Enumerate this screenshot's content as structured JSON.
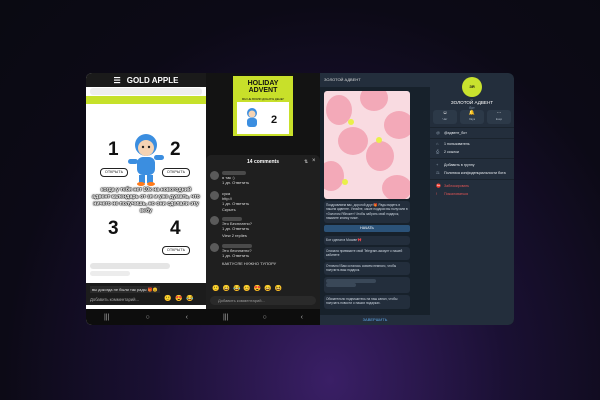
{
  "panel1": {
    "brand": "GOLD APPLE",
    "numbers": [
      "1",
      "2",
      "3",
      "4"
    ],
    "open_label": "ОТКРЫТЬ",
    "caption": "когда у тебя нет 10к на новогодний адвент календарь от зя и уже думать, что ничего не получишь, но они сделали эту вебу",
    "comment_chip": "вы докогда не были так рады 🎁😊",
    "comment_placeholder": "Добавить комментарий...",
    "emojis": [
      "🙂",
      "😍",
      "😂"
    ],
    "nav": [
      "|||",
      "○",
      "‹"
    ]
  },
  "panel2": {
    "card_title_1": "HOLIDAY",
    "card_title_2": "ADVENT",
    "card_sub": "МЫ НЕ ВЗЯЛИ ДОНАТЫ ДЕНЕГ",
    "card_num": "2",
    "comments_title": "14 comments",
    "comments": [
      {
        "text": "я так :)",
        "meta": "1 дн. Ответить"
      },
      {
        "text": "сука",
        "meta": ""
      },
      {
        "text": "http://",
        "meta": "1 дн. Ответить"
      },
      {
        "text": "Скрыть",
        "meta": ""
      },
      {
        "text": "Это Бесплатно?",
        "meta": "1 дн. Ответить"
      },
      {
        "text": "View 2 replies",
        "meta": ""
      },
      {
        "text": "Это бесплатно?",
        "meta": "1 дн. Ответить"
      },
      {
        "text": "КАКТУСЯЕ НУЖНО ТУПОРУ",
        "meta": ""
      }
    ],
    "emoji_row": "🙂😀😂😊😍😄😆",
    "comment_placeholder": "Добавить комментарий...",
    "nav": [
      "|||",
      "○",
      "‹"
    ]
  },
  "panel3": {
    "chat_title": "ЗОЛОТОЙ АДВЕНТ",
    "msg1": "Поздравляем вас, дорогой друг!🎁 Рады видеть в нашем адвенте. Узнайте, какие подарки вы получили в «Золотом Яблоке»! Чтобы забрать свой подарок, нажмите кнопку ниже.",
    "btn1": "НАЧАТЬ",
    "msg2": "Бот сделан в Москве 🎀",
    "msg3": "Сначала привяжите свой Telegram-аккаунт к нашей кабинете",
    "msg4": "Отлично! Вам осталось совсем немного, чтобы получить ваш подарок.",
    "msg5": "Обязательно подпишитесь на наш канал, чтобы получать новости о наших подарках.",
    "bottom": "ЗАВЕРШИТЬ"
  },
  "panel4": {
    "logo": "ЗЯ",
    "name": "ЗОЛОТОЙ АДВЕНТ",
    "sub": "бот",
    "actions": [
      {
        "icon": "☺",
        "label": "Чат"
      },
      {
        "icon": "🔔",
        "label": "Звук"
      },
      {
        "icon": "⋯",
        "label": "Ещё"
      }
    ],
    "rows": [
      {
        "icon": "@",
        "label": "@адвент_бот"
      },
      {
        "icon": "⌂",
        "label": "1 пользователь"
      },
      {
        "icon": "⎙",
        "label": "2 ссылки"
      },
      {
        "icon": "+",
        "label": "Добавить в группу"
      },
      {
        "icon": "⚖",
        "label": "Политика конфиденциальности бота"
      },
      {
        "icon": "⛔",
        "label": "Заблокировать"
      },
      {
        "icon": "!",
        "label": "Пожаловаться"
      }
    ]
  }
}
